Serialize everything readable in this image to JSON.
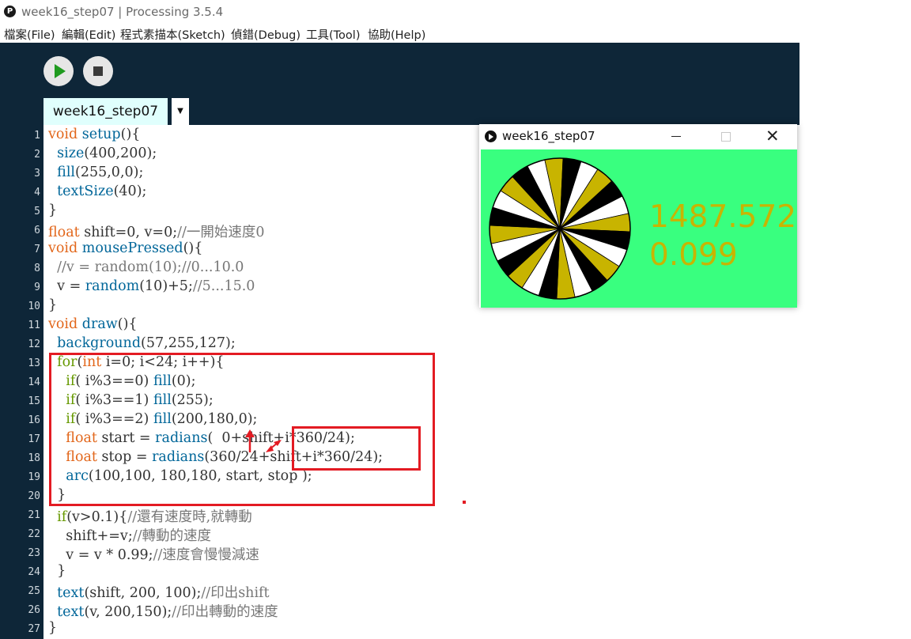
{
  "window": {
    "icon": "processing-icon",
    "title": "week16_step07 | Processing 3.5.4"
  },
  "menu": [
    "檔案(File)",
    "編輯(Edit)",
    "程式素描本(Sketch)",
    "偵錯(Debug)",
    "工具(Tool)",
    "協助(Help)"
  ],
  "toolbar": {
    "run_icon": "play-icon",
    "stop_icon": "stop-icon"
  },
  "tab": {
    "label": "week16_step07",
    "menu_arrow": "▼"
  },
  "editor": {
    "line_numbers": [
      "1",
      "2",
      "3",
      "4",
      "5",
      "6",
      "7",
      "8",
      "9",
      "10",
      "11",
      "12",
      "13",
      "14",
      "15",
      "16",
      "17",
      "18",
      "19",
      "20",
      "21",
      "22",
      "23",
      "24",
      "25",
      "26",
      "27"
    ],
    "lines": [
      [
        {
          "t": "void ",
          "c": "kw-type"
        },
        {
          "t": "setup",
          "c": "kw-fn"
        },
        {
          "t": "(){",
          "c": ""
        }
      ],
      [
        {
          "t": "  ",
          "c": ""
        },
        {
          "t": "size",
          "c": "kw-fn"
        },
        {
          "t": "(400,200);",
          "c": ""
        }
      ],
      [
        {
          "t": "  ",
          "c": ""
        },
        {
          "t": "fill",
          "c": "kw-fn"
        },
        {
          "t": "(255,0,0);",
          "c": ""
        }
      ],
      [
        {
          "t": "  ",
          "c": ""
        },
        {
          "t": "textSize",
          "c": "kw-fn"
        },
        {
          "t": "(40);",
          "c": ""
        }
      ],
      [
        {
          "t": "}",
          "c": ""
        }
      ],
      [
        {
          "t": "float ",
          "c": "kw-type"
        },
        {
          "t": "shift=0, v=0;",
          "c": ""
        },
        {
          "t": "//一開始速度0",
          "c": "cmt"
        }
      ],
      [
        {
          "t": "void ",
          "c": "kw-type"
        },
        {
          "t": "mousePressed",
          "c": "kw-fn"
        },
        {
          "t": "(){",
          "c": ""
        }
      ],
      [
        {
          "t": "  ",
          "c": ""
        },
        {
          "t": "//v = random(10);//0...10.0",
          "c": "cmt"
        }
      ],
      [
        {
          "t": "  v = ",
          "c": ""
        },
        {
          "t": "random",
          "c": "kw-fn"
        },
        {
          "t": "(10)+5;",
          "c": ""
        },
        {
          "t": "//5...15.0",
          "c": "cmt"
        }
      ],
      [
        {
          "t": "}",
          "c": ""
        }
      ],
      [
        {
          "t": "void ",
          "c": "kw-type"
        },
        {
          "t": "draw",
          "c": "kw-fn"
        },
        {
          "t": "(){",
          "c": ""
        }
      ],
      [
        {
          "t": "  ",
          "c": ""
        },
        {
          "t": "background",
          "c": "kw-fn"
        },
        {
          "t": "(57,255,127);",
          "c": ""
        }
      ],
      [
        {
          "t": "  ",
          "c": ""
        },
        {
          "t": "for",
          "c": "kw-ctl"
        },
        {
          "t": "(",
          "c": ""
        },
        {
          "t": "int",
          "c": "kw-type"
        },
        {
          "t": " i=0; i<24; i++){",
          "c": ""
        }
      ],
      [
        {
          "t": "    ",
          "c": ""
        },
        {
          "t": "if",
          "c": "kw-ctl"
        },
        {
          "t": "( i%3==0) ",
          "c": ""
        },
        {
          "t": "fill",
          "c": "kw-fn"
        },
        {
          "t": "(0);",
          "c": ""
        }
      ],
      [
        {
          "t": "    ",
          "c": ""
        },
        {
          "t": "if",
          "c": "kw-ctl"
        },
        {
          "t": "( i%3==1) ",
          "c": ""
        },
        {
          "t": "fill",
          "c": "kw-fn"
        },
        {
          "t": "(255);",
          "c": ""
        }
      ],
      [
        {
          "t": "    ",
          "c": ""
        },
        {
          "t": "if",
          "c": "kw-ctl"
        },
        {
          "t": "( i%3==2) ",
          "c": ""
        },
        {
          "t": "fill",
          "c": "kw-fn"
        },
        {
          "t": "(200,180,0);",
          "c": ""
        }
      ],
      [
        {
          "t": "    ",
          "c": ""
        },
        {
          "t": "float",
          "c": "kw-type"
        },
        {
          "t": " start = ",
          "c": ""
        },
        {
          "t": "radians",
          "c": "kw-fn"
        },
        {
          "t": "(  0+shift+i*360/24);",
          "c": ""
        }
      ],
      [
        {
          "t": "    ",
          "c": ""
        },
        {
          "t": "float",
          "c": "kw-type"
        },
        {
          "t": " stop = ",
          "c": ""
        },
        {
          "t": "radians",
          "c": "kw-fn"
        },
        {
          "t": "(360/24+shift+i*360/24);",
          "c": ""
        }
      ],
      [
        {
          "t": "    ",
          "c": ""
        },
        {
          "t": "arc",
          "c": "kw-fn"
        },
        {
          "t": "(100,100, 180,180, start, stop );",
          "c": ""
        }
      ],
      [
        {
          "t": "  }",
          "c": ""
        }
      ],
      [
        {
          "t": "  ",
          "c": ""
        },
        {
          "t": "if",
          "c": "kw-ctl"
        },
        {
          "t": "(v>0.1){",
          "c": ""
        },
        {
          "t": "//還有速度時,就轉動",
          "c": "cmt"
        }
      ],
      [
        {
          "t": "    shift+=v;",
          "c": ""
        },
        {
          "t": "//轉動的速度",
          "c": "cmt"
        }
      ],
      [
        {
          "t": "    v = v * 0.99;",
          "c": ""
        },
        {
          "t": "//速度會慢慢減速",
          "c": "cmt"
        }
      ],
      [
        {
          "t": "  }",
          "c": ""
        }
      ],
      [
        {
          "t": "  ",
          "c": ""
        },
        {
          "t": "text",
          "c": "kw-fn"
        },
        {
          "t": "(shift, 200, 100);",
          "c": ""
        },
        {
          "t": "//印出shift",
          "c": "cmt"
        }
      ],
      [
        {
          "t": "  ",
          "c": ""
        },
        {
          "t": "text",
          "c": "kw-fn"
        },
        {
          "t": "(v, 200,150);",
          "c": ""
        },
        {
          "t": "//印出轉動的速度",
          "c": "cmt"
        }
      ],
      [
        {
          "t": "}",
          "c": ""
        }
      ]
    ]
  },
  "annotations": {
    "color": "#e31b23",
    "arrow_icon": "red-arrow-icon"
  },
  "sketch_window": {
    "title": "week16_step07",
    "icon": "play-icon",
    "controls": {
      "minimize": "minimize-icon",
      "maximize": "maximize-icon",
      "close": "✕"
    },
    "background": "#39ff7f",
    "wheel": {
      "segments": 24,
      "colors": [
        "#000000",
        "#ffffff",
        "#c8b400"
      ],
      "shift_deg": 1487.572
    },
    "text_color": "#c8b400",
    "shift_text": "1487.572",
    "v_text": "0.099"
  },
  "colors": {
    "header_bg": "#0e2638",
    "tab_bg": "#e0fffd",
    "type_keyword": "#e2661a",
    "function": "#006699",
    "control": "#669900",
    "comment": "#777777"
  }
}
